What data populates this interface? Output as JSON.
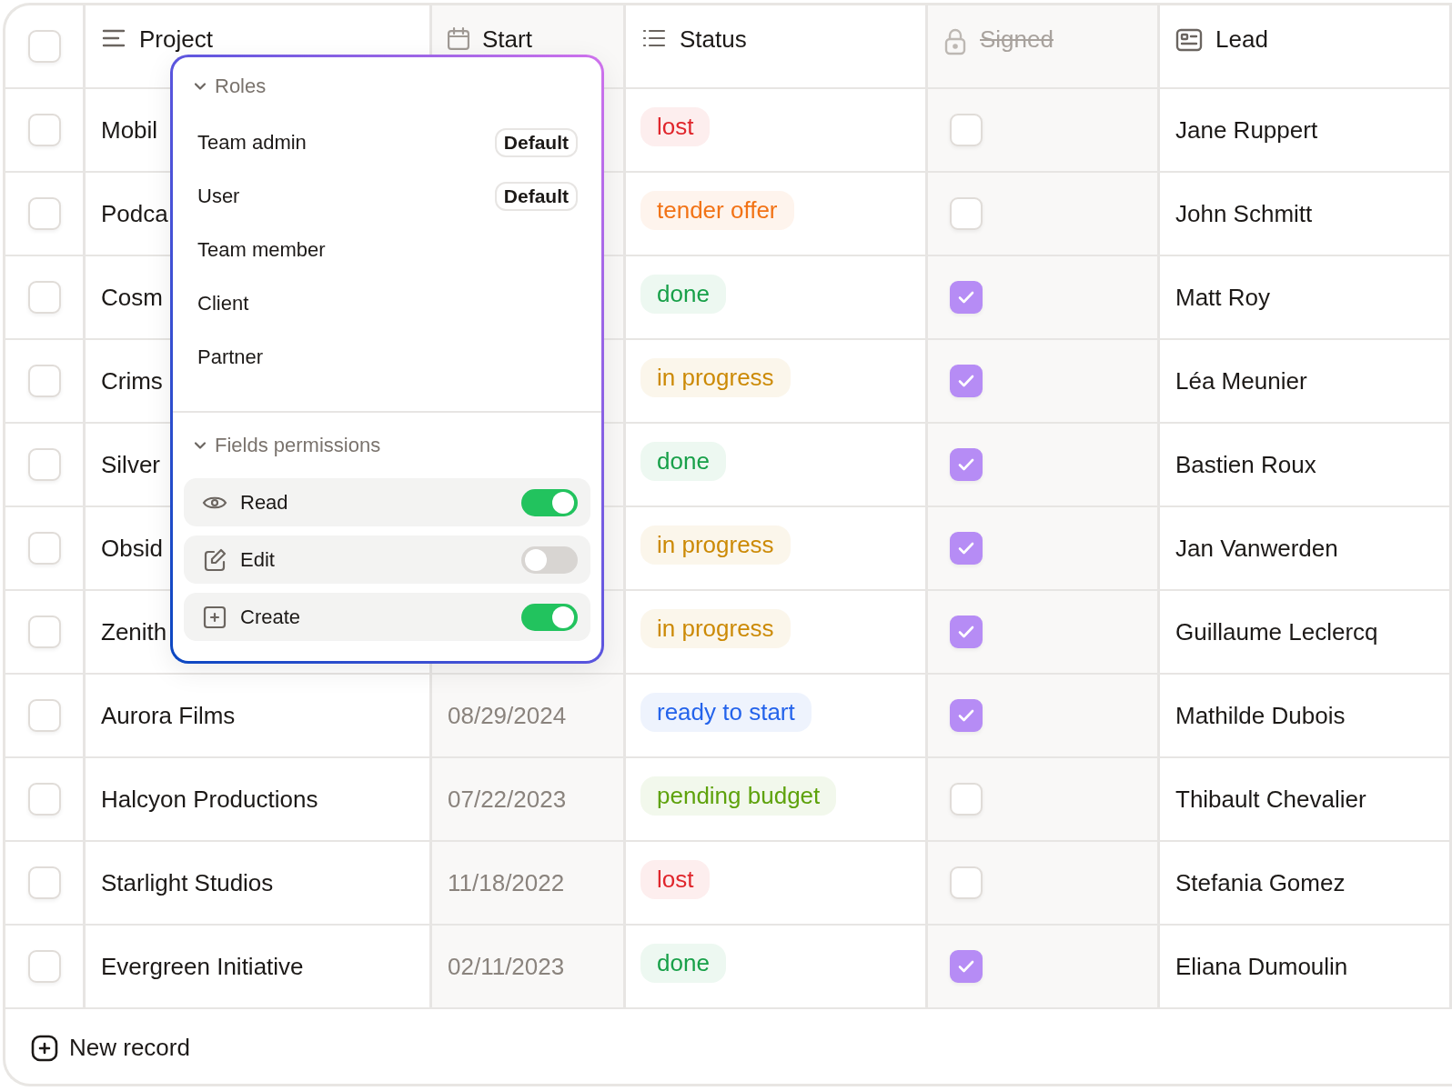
{
  "table": {
    "select_all": false,
    "columns": [
      {
        "kind": "text",
        "label": "Project",
        "locked": false
      },
      {
        "kind": "date",
        "label": "Start",
        "locked": false
      },
      {
        "kind": "status",
        "label": "Status",
        "locked": false
      },
      {
        "kind": "checkbox",
        "label": "Signed",
        "locked": true
      },
      {
        "kind": "person",
        "label": "Lead",
        "locked": false
      }
    ],
    "rows": [
      {
        "selected": false,
        "project": "Mobil",
        "status": {
          "label": "lost",
          "color": "#e0262c"
        },
        "signed": false,
        "lead": "Jane Ruppert"
      },
      {
        "selected": false,
        "project": "Podca",
        "status": {
          "label": "tender offer",
          "color": "#f27316"
        },
        "signed": false,
        "lead": "John Schmitt"
      },
      {
        "selected": false,
        "project": "Cosm",
        "status": {
          "label": "done",
          "color": "#18a049"
        },
        "signed": true,
        "lead": "Matt Roy"
      },
      {
        "selected": false,
        "project": "Crims",
        "status": {
          "label": "in progress",
          "color": "#cc8a06"
        },
        "signed": true,
        "lead": "Léa Meunier"
      },
      {
        "selected": false,
        "project": "Silver",
        "status": {
          "label": "done",
          "color": "#18a049"
        },
        "signed": true,
        "lead": "Bastien Roux"
      },
      {
        "selected": false,
        "project": "Obsid",
        "status": {
          "label": "in progress",
          "color": "#cc8a06"
        },
        "signed": true,
        "lead": "Jan Vanwerden"
      },
      {
        "selected": false,
        "project": "Zenith",
        "status": {
          "label": "in progress",
          "color": "#cc8a06"
        },
        "signed": true,
        "lead": "Guillaume Leclercq"
      },
      {
        "selected": false,
        "project": "Aurora Films",
        "start": "08/29/2024",
        "status": {
          "label": "ready to start",
          "color": "#2463eb"
        },
        "signed": true,
        "lead": "Mathilde Dubois"
      },
      {
        "selected": false,
        "project": "Halcyon Productions",
        "start": "07/22/2023",
        "status": {
          "label": "pending budget",
          "color": "#5ea20c"
        },
        "signed": false,
        "lead": "Thibault Chevalier"
      },
      {
        "selected": false,
        "project": "Starlight Studios",
        "start": "11/18/2022",
        "status": {
          "label": "lost",
          "color": "#e0262c"
        },
        "signed": false,
        "lead": "Stefania Gomez"
      },
      {
        "selected": false,
        "project": "Evergreen Initiative",
        "start": "02/11/2023",
        "status": {
          "label": "done",
          "color": "#18a049"
        },
        "signed": true,
        "lead": "Eliana Dumoulin"
      }
    ],
    "footer": {
      "label": "New record"
    }
  },
  "popover": {
    "roles": {
      "title": "Roles",
      "expanded": true,
      "items": [
        {
          "label": "Team admin",
          "badge": "Default"
        },
        {
          "label": "User",
          "badge": "Default"
        },
        {
          "label": "Team member"
        },
        {
          "label": "Client"
        },
        {
          "label": "Partner"
        }
      ]
    },
    "fields_permissions": {
      "title": "Fields permissions",
      "expanded": true,
      "items": [
        {
          "kind": "read",
          "label": "Read",
          "on": true
        },
        {
          "kind": "edit",
          "label": "Edit",
          "on": false
        },
        {
          "kind": "create",
          "label": "Create",
          "on": true
        }
      ]
    }
  }
}
